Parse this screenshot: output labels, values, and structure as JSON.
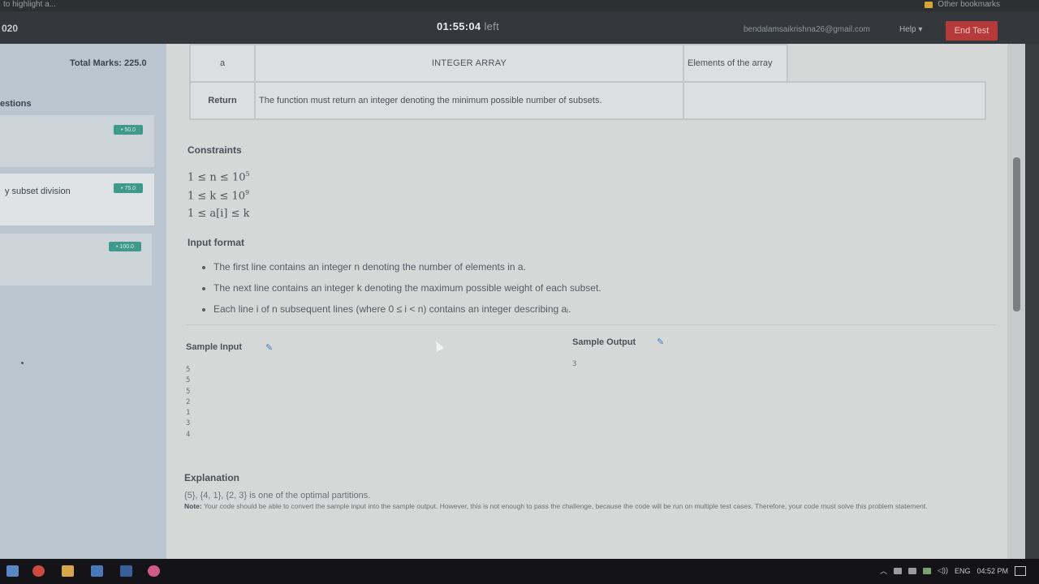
{
  "browser": {
    "bookmark_left": "to highlight a...",
    "bookmark_right": "Other bookmarks"
  },
  "header": {
    "year_fragment": "020",
    "timer": "01:55:04",
    "timer_suffix": "left",
    "email": "bendalamsaikrishna26@gmail.com",
    "help_label": "Help ▾",
    "end_test_label": "End Test"
  },
  "sidebar": {
    "total_marks": "Total Marks: 225.0",
    "questions_heading": "estions",
    "questions": [
      {
        "title": "",
        "marks": "• 50.0"
      },
      {
        "title": "y subset division",
        "marks": "• 75.0"
      },
      {
        "title": "",
        "marks": "• 100.0"
      }
    ]
  },
  "params_table": {
    "param_name": "a",
    "param_type": "INTEGER ARRAY",
    "param_desc": "Elements of the array",
    "return_label": "Return",
    "return_text": "The function must return an integer denoting the minimum possible number of subsets."
  },
  "constraints": {
    "heading": "Constraints",
    "lines": [
      "1 ≤ n ≤ 10",
      "1 ≤ k ≤ 10",
      "1 ≤ a[i] ≤ k"
    ],
    "exponents": [
      "5",
      "9",
      ""
    ]
  },
  "input_format": {
    "heading": "Input format",
    "items": [
      "The first line contains an integer n denoting the number of elements in a.",
      "The next line contains an integer k denoting the maximum possible weight of each subset.",
      "Each line i of n subsequent lines (where 0 ≤ i < n) contains an integer describing aᵢ."
    ]
  },
  "sample": {
    "input_label": "Sample Input",
    "output_label": "Sample Output",
    "input_lines": [
      "5",
      "5",
      "5",
      "2",
      "1",
      "3",
      "4"
    ],
    "output_lines": [
      "3"
    ]
  },
  "explanation": {
    "heading": "Explanation",
    "text": "{5}, {4, 1}, {2, 3} is one of the optimal partitions.",
    "note_label": "Note:",
    "note_text": "Your code should be able to convert the sample input into the sample output. However, this is not enough to pass the challenge, because the code will be run on multiple test cases. Therefore, your code must solve this problem statement."
  },
  "taskbar": {
    "lang": "ENG",
    "time": "04:52 PM"
  },
  "colors": {
    "end_test": "#b63a3a",
    "marks_badge": "#3f9a8c",
    "link": "#3b7ec9"
  }
}
